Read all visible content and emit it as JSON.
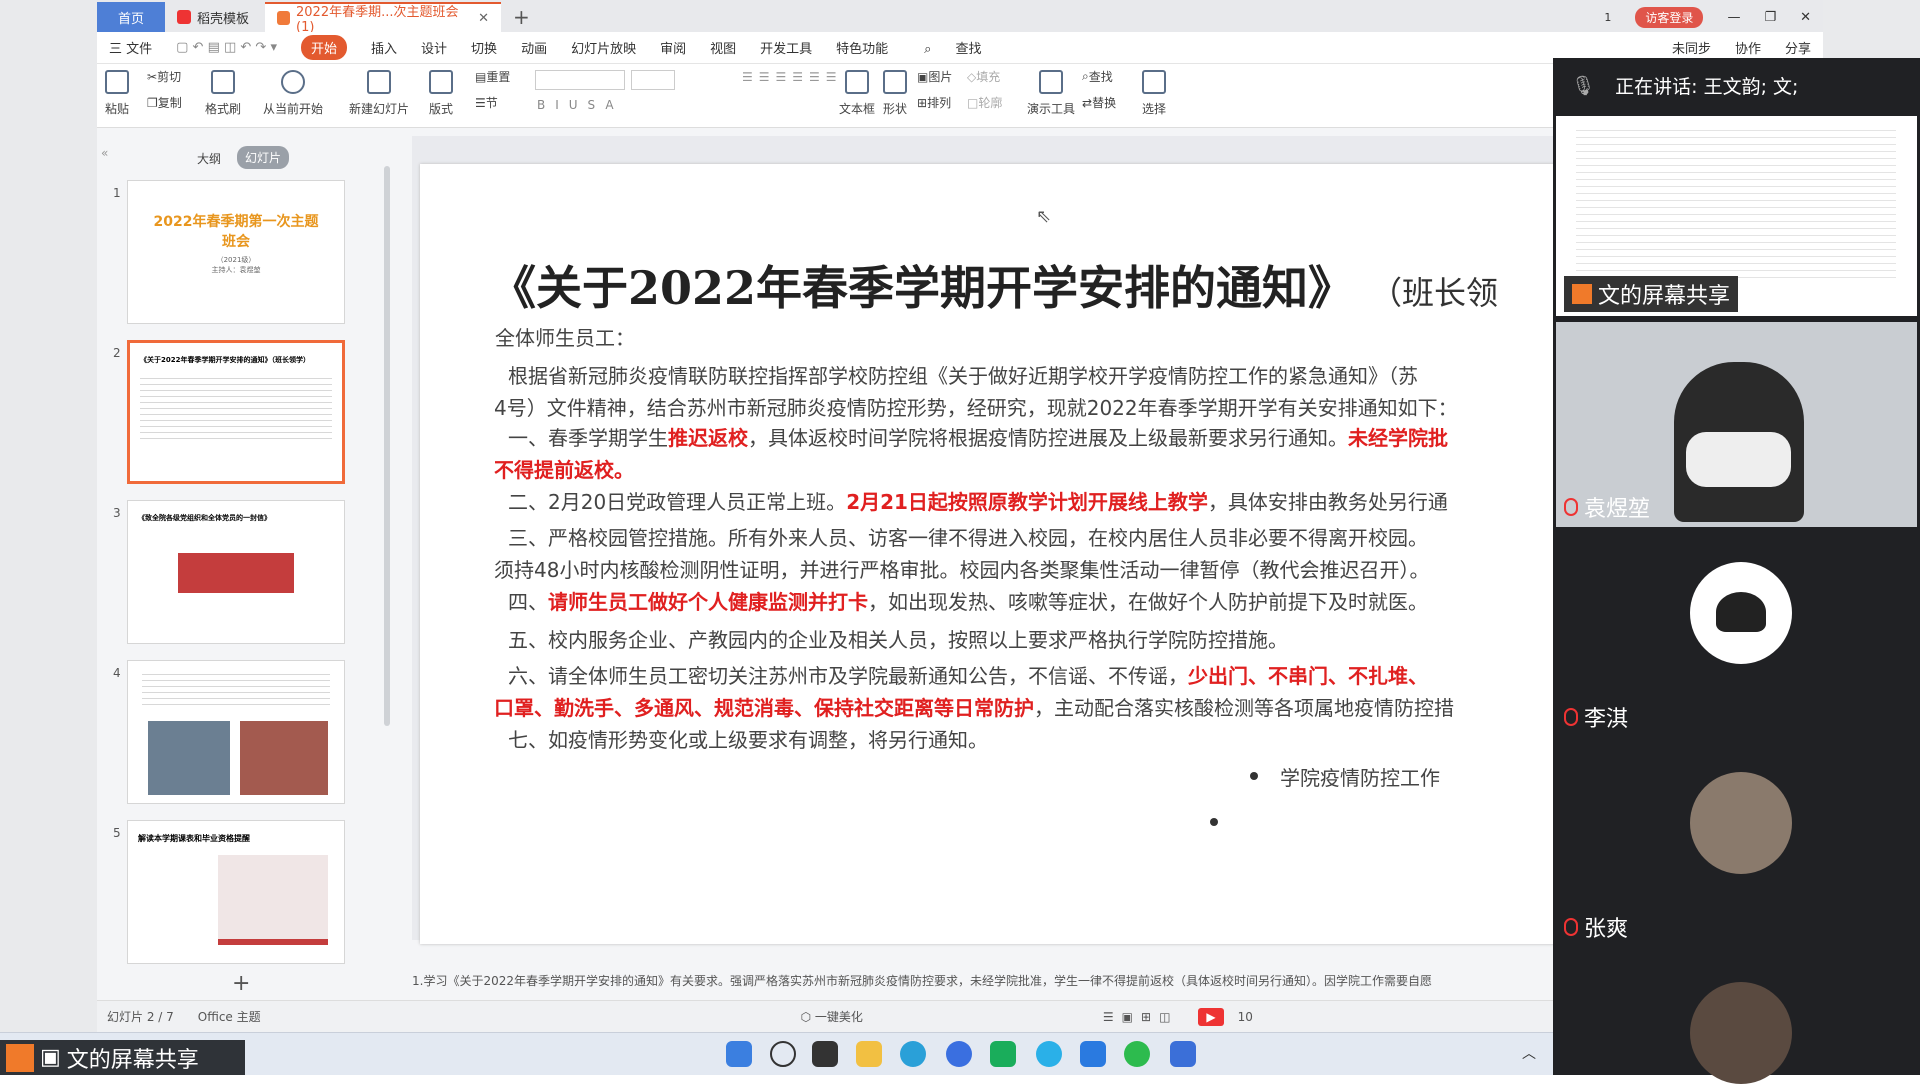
{
  "tabs": {
    "home": "首页",
    "template": "稻壳模板",
    "doc": "2022年春季期...次主题班会(1)"
  },
  "window": {
    "badge": "1",
    "login": "访客登录"
  },
  "menu": [
    "三 文件",
    "开始",
    "插入",
    "设计",
    "切换",
    "动画",
    "幻灯片放映",
    "审阅",
    "视图",
    "开发工具",
    "特色功能",
    "查找"
  ],
  "menu_right": {
    "sync": "未同步",
    "collab": "协作",
    "share": "分享"
  },
  "ribbon": {
    "paste": "粘贴",
    "cut": "剪切",
    "copy": "复制",
    "format_painter": "格式刷",
    "from_current": "从当前开始",
    "new_slide": "新建幻灯片",
    "layout": "版式",
    "reset": "重置",
    "section": "节",
    "textbox": "文本框",
    "shape": "形状",
    "picture": "图片",
    "arrange": "排列",
    "fill": "填充",
    "outline": "轮廓",
    "present_tools": "演示工具",
    "find": "查找",
    "replace": "替换",
    "select": "选择"
  },
  "pane": {
    "outline": "大纲",
    "slides": "幻灯片"
  },
  "thumbs": [
    {
      "num": "1",
      "title": "2022年春季期第一次主题班会",
      "sub": "（2021级）",
      "host": "主持人：袁煜堃"
    },
    {
      "num": "2",
      "title": "《关于2022年春季学期开学安排的通知》（班长领学）"
    },
    {
      "num": "3",
      "title": "《致全院各级党组织和全体党员的一封信》"
    },
    {
      "num": "4"
    },
    {
      "num": "5",
      "title": "解读本学期课表和毕业资格提醒"
    }
  ],
  "slide": {
    "title": "《关于2022年春季学期开学安排的通知》",
    "subtitle": "（班长领",
    "p0": "全体师生员工：",
    "p1a": "根据省新冠肺炎疫情联防联控指挥部学校防控组《关于做好近期学校开学疫情防控工作的紧急通知》（苏",
    "p1b": "4号）文件精神，结合苏州市新冠肺炎疫情防控形势，经研究，现就2022年春季学期开学有关安排通知如下：",
    "p2a": "一、春季学期学生",
    "p2b": "推迟返校",
    "p2c": "，具体返校时间学院将根据疫情防控进展及上级最新要求另行通知。",
    "p2d": "未经学院批",
    "p2e": "不得提前返校。",
    "p3a": "二、2月20日党政管理人员正常上班。",
    "p3b": "2月21日起按照原教学计划开展线上教学",
    "p3c": "，具体安排由教务处另行通",
    "p4a": "三、严格校园管控措施。所有外来人员、访客一律不得进入校园，在校内居住人员非必要不得离开校园。",
    "p4b": "须持48小时内核酸检测阴性证明，并进行严格审批。校园内各类聚集性活动一律暂停（教代会推迟召开）。",
    "p5a": "四、",
    "p5b": "请师生员工做好个人健康监测并打卡",
    "p5c": "，如出现发热、咳嗽等症状，在做好个人防护前提下及时就医。",
    "p6": "五、校内服务企业、产教园内的企业及相关人员，按照以上要求严格执行学院防控措施。",
    "p7a": "六、请全体师生员工密切关注苏州市及学院最新通知公告，不信谣、不传谣，",
    "p7b": "少出门、不串门、不扎堆、",
    "p7c": "口罩、勤洗手、多通风、规范消毒、保持社交距离等日常防护",
    "p7d": "，主动配合落实核酸检测等各项属地疫情防控措",
    "p8": "七、如疫情形势变化或上级要求有调整，将另行通知。",
    "sign": "学院疫情防控工作"
  },
  "notes": "1.学习《关于2022年春季学期开学安排的通知》有关要求。强调严格落实苏州市新冠肺炎疫情防控要求，未经学院批准，学生一律不得提前返校（具体返校时间另行通知）。因学院工作需要自愿",
  "status": {
    "slide": "幻灯片 2 / 7",
    "theme": "Office 主题",
    "beautify": "一键美化",
    "zoom": "10"
  },
  "meeting": {
    "speaking": "正在讲话: 王文韵; 文;",
    "screen_share": "文的屏幕共享",
    "p1": "袁煜堃",
    "p2": "李淇",
    "p3": "张爽"
  },
  "share_label": "文的屏幕共享",
  "colors": {
    "accent": "#e35a2f",
    "red_text": "#e02020",
    "meeting_bg": "#202124"
  }
}
